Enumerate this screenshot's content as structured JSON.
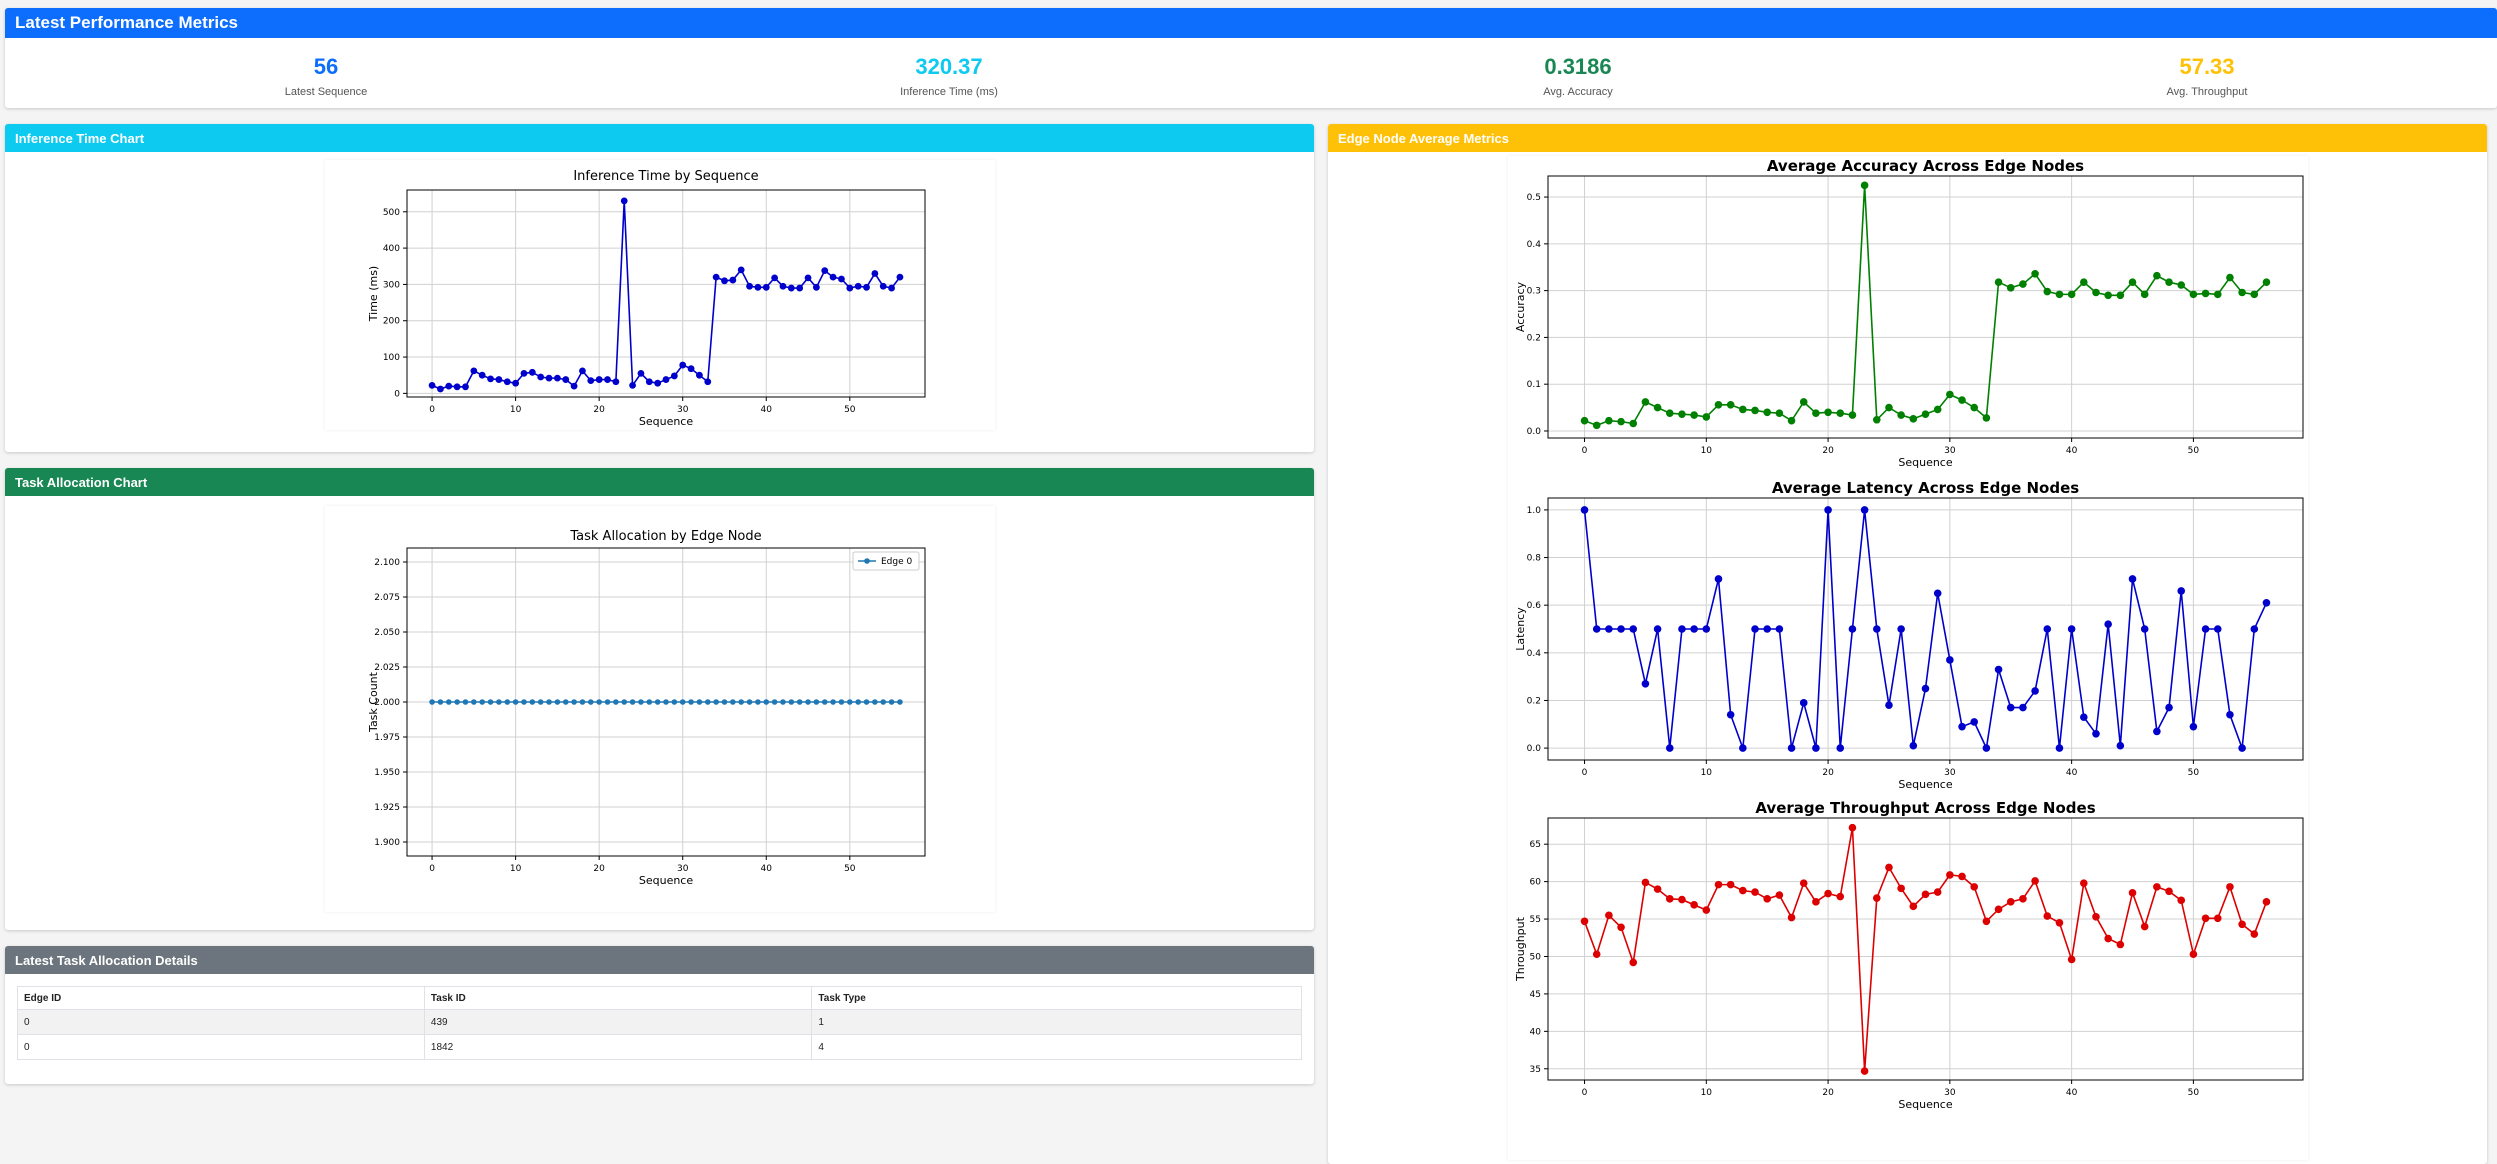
{
  "metrics": {
    "header": "Latest Performance Metrics",
    "header_color": "#0d6efd",
    "items": [
      {
        "value": "56",
        "label": "Latest Sequence",
        "color": "#0d6efd"
      },
      {
        "value": "320.37",
        "label": "Inference Time (ms)",
        "color": "#0dcaf0"
      },
      {
        "value": "0.3186",
        "label": "Avg. Accuracy",
        "color": "#198754"
      },
      {
        "value": "57.33",
        "label": "Avg. Throughput",
        "color": "#ffc107"
      }
    ]
  },
  "inference_card": {
    "header": "Inference Time Chart",
    "color": "#0dcaf0"
  },
  "task_card": {
    "header": "Task Allocation Chart",
    "color": "#198754"
  },
  "edge_card": {
    "header": "Edge Node Average Metrics",
    "color": "#ffc107"
  },
  "table_card": {
    "header": "Latest Task Allocation Details",
    "color": "#6c757d",
    "columns": [
      "Edge ID",
      "Task ID",
      "Task Type"
    ],
    "rows": [
      [
        "0",
        "439",
        "1"
      ],
      [
        "0",
        "1842",
        "4"
      ]
    ]
  },
  "chart_data": [
    {
      "type": "line",
      "title": "Inference Time by Sequence",
      "xlabel": "Sequence",
      "ylabel": "Time (ms)",
      "xlim": [
        -3,
        59
      ],
      "ylim": [
        -10,
        560
      ],
      "xticks": [
        0,
        10,
        20,
        30,
        40,
        50
      ],
      "yticks": [
        0,
        100,
        200,
        300,
        400,
        500
      ],
      "grid": true,
      "color": "#0000cc",
      "series": [
        {
          "values": [
            22,
            12,
            20,
            18,
            18,
            62,
            50,
            40,
            38,
            32,
            28,
            55,
            58,
            45,
            42,
            42,
            38,
            20,
            62,
            35,
            38,
            38,
            32,
            530,
            22,
            55,
            32,
            28,
            38,
            48,
            78,
            68,
            50,
            32,
            320,
            310,
            312,
            340,
            295,
            292,
            292,
            318,
            295,
            290,
            290,
            318,
            292,
            338,
            320,
            315,
            290,
            295,
            292,
            330,
            295,
            290,
            320
          ]
        }
      ]
    },
    {
      "type": "line",
      "title": "Task Allocation by Edge Node",
      "xlabel": "Sequence",
      "ylabel": "Task Count",
      "xlim": [
        -3,
        59
      ],
      "ylim": [
        1.89,
        2.11
      ],
      "xticks": [
        0,
        10,
        20,
        30,
        40,
        50
      ],
      "yticks": [
        1.9,
        1.925,
        1.95,
        1.975,
        2.0,
        2.025,
        2.05,
        2.075,
        2.1
      ],
      "ytick_labels": [
        "1.900",
        "1.925",
        "1.950",
        "1.975",
        "2.000",
        "2.025",
        "2.050",
        "2.075",
        "2.100"
      ],
      "grid": true,
      "legend": "top-right",
      "color": "#1f77b4",
      "series": [
        {
          "name": "Edge 0",
          "values": [
            2,
            2,
            2,
            2,
            2,
            2,
            2,
            2,
            2,
            2,
            2,
            2,
            2,
            2,
            2,
            2,
            2,
            2,
            2,
            2,
            2,
            2,
            2,
            2,
            2,
            2,
            2,
            2,
            2,
            2,
            2,
            2,
            2,
            2,
            2,
            2,
            2,
            2,
            2,
            2,
            2,
            2,
            2,
            2,
            2,
            2,
            2,
            2,
            2,
            2,
            2,
            2,
            2,
            2,
            2,
            2,
            2
          ]
        }
      ]
    },
    {
      "type": "line",
      "title": "Average Accuracy Across Edge Nodes",
      "xlabel": "Sequence",
      "ylabel": "Accuracy",
      "xlim": [
        -3,
        59
      ],
      "ylim": [
        -0.015,
        0.545
      ],
      "xticks": [
        0,
        10,
        20,
        30,
        40,
        50
      ],
      "yticks": [
        0.0,
        0.1,
        0.2,
        0.3,
        0.4,
        0.5
      ],
      "ytick_labels": [
        "0.0",
        "0.1",
        "0.2",
        "0.3",
        "0.4",
        "0.5"
      ],
      "grid": true,
      "color": "#008000",
      "series": [
        {
          "values": [
            0.022,
            0.012,
            0.022,
            0.02,
            0.016,
            0.062,
            0.05,
            0.038,
            0.036,
            0.034,
            0.03,
            0.056,
            0.056,
            0.046,
            0.044,
            0.04,
            0.038,
            0.022,
            0.062,
            0.038,
            0.04,
            0.038,
            0.034,
            0.525,
            0.024,
            0.05,
            0.034,
            0.026,
            0.036,
            0.046,
            0.078,
            0.066,
            0.05,
            0.028,
            0.318,
            0.306,
            0.314,
            0.336,
            0.298,
            0.292,
            0.292,
            0.318,
            0.296,
            0.29,
            0.29,
            0.318,
            0.292,
            0.332,
            0.318,
            0.312,
            0.292,
            0.294,
            0.292,
            0.328,
            0.296,
            0.292,
            0.318
          ]
        }
      ]
    },
    {
      "type": "line",
      "title": "Average Latency Across Edge Nodes",
      "xlabel": "Sequence",
      "ylabel": "Latency",
      "xlim": [
        -3,
        59
      ],
      "ylim": [
        -0.05,
        1.05
      ],
      "xticks": [
        0,
        10,
        20,
        30,
        40,
        50
      ],
      "yticks": [
        0.0,
        0.2,
        0.4,
        0.6,
        0.8,
        1.0
      ],
      "ytick_labels": [
        "0.0",
        "0.2",
        "0.4",
        "0.6",
        "0.8",
        "1.0"
      ],
      "grid": true,
      "color": "#0000cc",
      "series": [
        {
          "values": [
            1.0,
            0.5,
            0.5,
            0.5,
            0.5,
            0.27,
            0.5,
            0.0,
            0.5,
            0.5,
            0.5,
            0.71,
            0.14,
            0.0,
            0.5,
            0.5,
            0.5,
            0.0,
            0.19,
            0.0,
            1.0,
            0.0,
            0.5,
            1.0,
            0.5,
            0.18,
            0.5,
            0.01,
            0.25,
            0.65,
            0.37,
            0.09,
            0.11,
            0.0,
            0.33,
            0.17,
            0.17,
            0.24,
            0.5,
            0.0,
            0.5,
            0.13,
            0.06,
            0.52,
            0.01,
            0.71,
            0.5,
            0.07,
            0.17,
            0.66,
            0.09,
            0.5,
            0.5,
            0.14,
            0.0,
            0.5,
            0.61
          ]
        }
      ]
    },
    {
      "type": "line",
      "title": "Average Throughput Across Edge Nodes",
      "xlabel": "Sequence",
      "ylabel": "Throughput",
      "xlim": [
        -3,
        59
      ],
      "ylim": [
        33.5,
        68.5
      ],
      "xticks": [
        0,
        10,
        20,
        30,
        40,
        50
      ],
      "yticks": [
        35,
        40,
        45,
        50,
        55,
        60,
        65
      ],
      "grid": true,
      "color": "#dd0000",
      "series": [
        {
          "values": [
            54.7,
            50.3,
            55.5,
            53.9,
            49.2,
            59.9,
            59.0,
            57.7,
            57.6,
            56.9,
            56.2,
            59.6,
            59.6,
            58.8,
            58.6,
            57.7,
            58.2,
            55.2,
            59.8,
            57.3,
            58.4,
            58.0,
            67.2,
            34.7,
            57.8,
            61.9,
            59.1,
            56.7,
            58.3,
            58.6,
            60.9,
            60.7,
            59.3,
            54.7,
            56.3,
            57.3,
            57.7,
            60.1,
            55.4,
            54.5,
            49.6,
            59.8,
            55.3,
            52.4,
            51.6,
            58.5,
            54.0,
            59.3,
            58.7,
            57.5,
            50.3,
            55.1,
            55.1,
            59.3,
            54.3,
            53.0,
            57.3
          ]
        }
      ]
    }
  ]
}
